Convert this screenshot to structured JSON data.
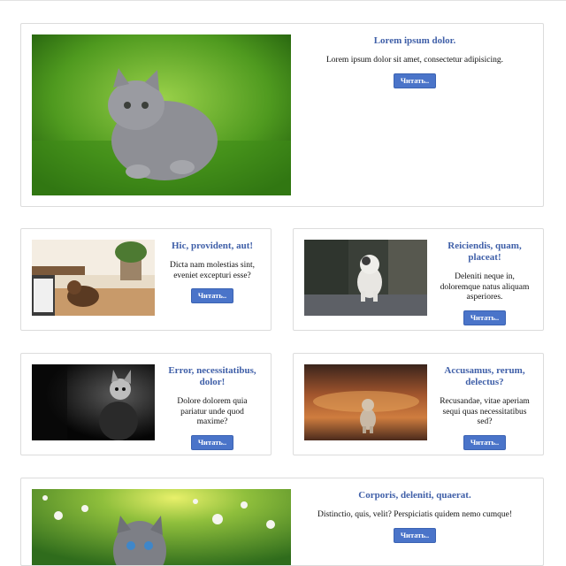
{
  "cards": [
    {
      "title": "Lorem ipsum dolor.",
      "text": "Lorem ipsum dolor sit amet, consectetur adipisicing.",
      "button": "Читать.."
    },
    {
      "title": "Hic, provident, aut!",
      "text": "Dicta nam molestias sint, eveniet excepturi esse?",
      "button": "Читать.."
    },
    {
      "title": "Reiciendis, quam, placeat!",
      "text": "Deleniti neque in, doloremque natus aliquam asperiores.",
      "button": "Читать.."
    },
    {
      "title": "Error, necessitatibus, dolor!",
      "text": "Dolore dolorem quia pariatur unde quod maxime?",
      "button": "Читать.."
    },
    {
      "title": "Accusamus, rerum, delectus?",
      "text": "Recusandae, vitae aperiam sequi quas necessitatibus sed?",
      "button": "Читать.."
    },
    {
      "title": "Corporis, deleniti, quaerat.",
      "text": "Distinctio, quis, velit? Perspiciatis quidem nemo cumque!",
      "button": "Читать.."
    }
  ]
}
